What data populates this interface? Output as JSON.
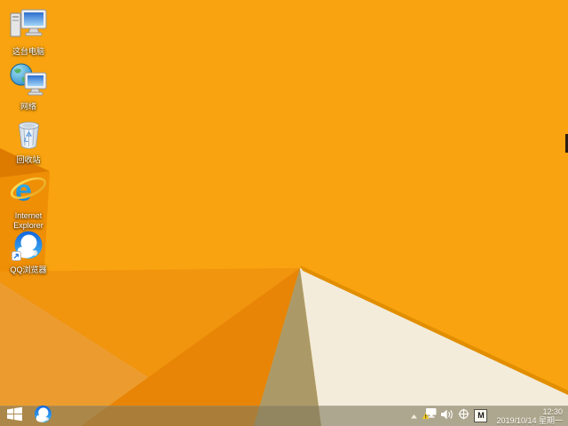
{
  "wallpaper": {
    "colors": {
      "bright": "#F8A30F",
      "wedge_dark": "#DD7B01",
      "left_column": "#EF8F06",
      "fan_medium": "#F1940E",
      "fan_light": "#EC9C2F",
      "fan_dark": "#E88406",
      "tan_shadow": "#AB9A67",
      "cream": "#F3ECDB",
      "edge_stripe": "#E18E00",
      "edge_mark": "#2E1D12"
    }
  },
  "desktop": {
    "icons": [
      {
        "name": "this-pc",
        "label": "这台电脑"
      },
      {
        "name": "network",
        "label": "网络"
      },
      {
        "name": "recycle-bin",
        "label": "回收站"
      },
      {
        "name": "internet-explorer",
        "label": "Internet Explorer"
      },
      {
        "name": "qq-browser",
        "label": "QQ浏览器"
      }
    ]
  },
  "taskbar": {
    "pinned": [
      {
        "name": "qq-browser"
      }
    ],
    "tray": {
      "icon_names": [
        "chevron-up",
        "network-warning",
        "volume",
        "crosshair",
        "ime-mode"
      ],
      "ime_letter": "M",
      "time": "12:30",
      "date": "2019/10/14 星期一"
    }
  }
}
